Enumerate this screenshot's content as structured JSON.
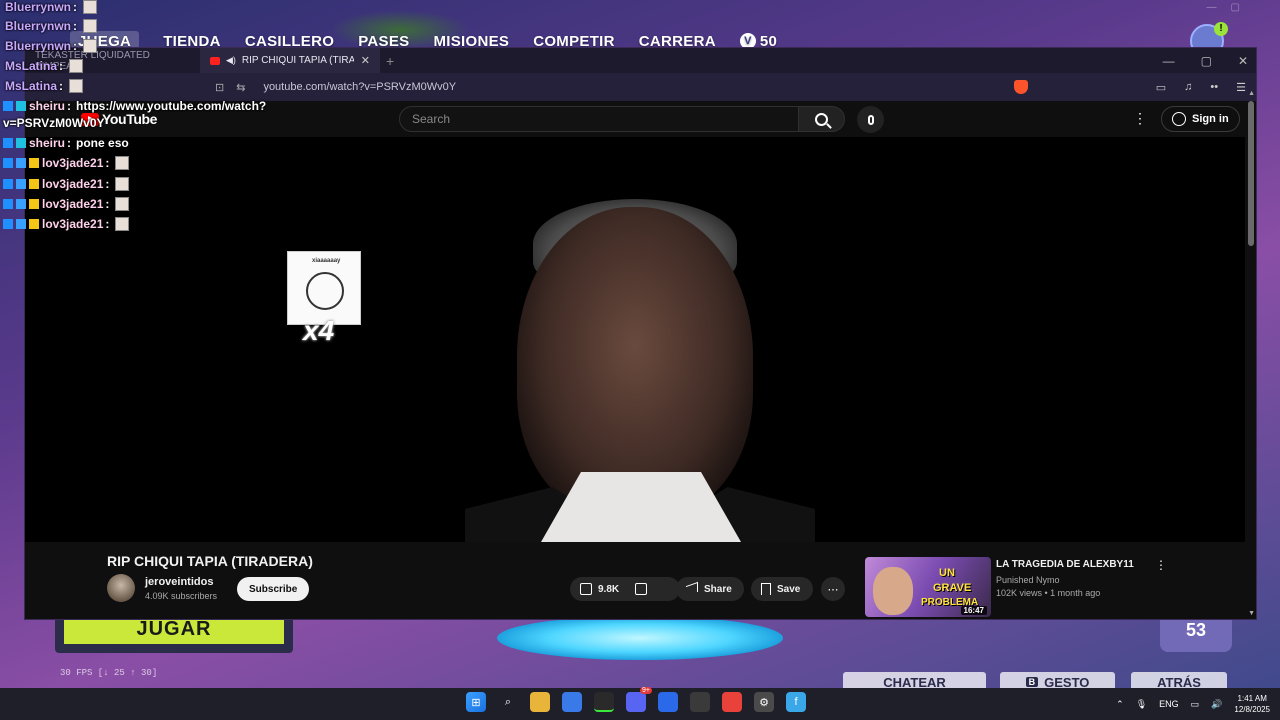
{
  "game": {
    "nav": [
      {
        "label": "JUEGA",
        "active": true
      },
      {
        "label": "TIENDA",
        "active": false
      },
      {
        "label": "CASILLERO",
        "active": false
      },
      {
        "label": "PASES",
        "active": false
      },
      {
        "label": "MISIONES",
        "active": false
      },
      {
        "label": "COMPETIR",
        "active": false
      },
      {
        "label": "CARRERA",
        "active": false
      }
    ],
    "vbucks_symbol": "V",
    "vbucks": "50",
    "avatar_badge": "!",
    "jugar_label": "JUGAR",
    "fps_text": "30 FPS [↓ 25 ↑ 30]",
    "level": "53",
    "footer_buttons": [
      {
        "key": "",
        "label": "CHATEAR"
      },
      {
        "key": "B",
        "label": "GESTO"
      },
      {
        "key": "",
        "label": "ATRÁS"
      }
    ]
  },
  "chat": [
    {
      "user": "Bluerrynwn",
      "message": "",
      "emote": true,
      "badges": [],
      "color": "purple"
    },
    {
      "user": "Bluerrynwn",
      "message": "",
      "emote": true,
      "badges": [],
      "color": "purple"
    },
    {
      "user": "Bluerrynwn",
      "message": "",
      "emote": true,
      "badges": [],
      "color": "purple"
    },
    {
      "user": "MsLatina",
      "message": "",
      "emote": true,
      "badges": [],
      "color": "purple"
    },
    {
      "user": "MsLatina",
      "message": "",
      "emote": true,
      "badges": [],
      "color": "purple"
    },
    {
      "user": "sheiru",
      "message": "https://www.youtube.com/watch?",
      "emote": false,
      "badges": [
        "b1",
        "b2"
      ],
      "color": "pink"
    },
    {
      "user": "",
      "message": "v=PSRVzM0Wv0Y",
      "emote": false,
      "badges": [],
      "color": "pink"
    },
    {
      "user": "sheiru",
      "message": "pone eso",
      "emote": false,
      "badges": [
        "b1",
        "b2"
      ],
      "color": "pink"
    },
    {
      "user": "lov3jade21",
      "message": "",
      "emote": true,
      "badges": [
        "b1",
        "b4",
        "b3"
      ],
      "color": "pink"
    },
    {
      "user": "lov3jade21",
      "message": "",
      "emote": true,
      "badges": [
        "b1",
        "b4",
        "b3"
      ],
      "color": "pink"
    },
    {
      "user": "lov3jade21",
      "message": "",
      "emote": true,
      "badges": [
        "b1",
        "b4",
        "b3"
      ],
      "color": "pink"
    },
    {
      "user": "lov3jade21",
      "message": "",
      "emote": true,
      "badges": [
        "b1",
        "b4",
        "b3"
      ],
      "color": "pink"
    }
  ],
  "browser": {
    "tabs": [
      {
        "title": "TEKASTER LIQUIDATED PIMPEA...",
        "active": false
      },
      {
        "title": "RIP CHIQUI TAPIA (TIRADERA)",
        "active": true
      }
    ],
    "url": "youtube.com/watch?v=PSRVzM0Wv0Y"
  },
  "youtube": {
    "logo": "YouTube",
    "search_placeholder": "Search",
    "signin": "Sign in",
    "sticker_label": "x4",
    "sticker_caption": "xiaaaaaay",
    "video_title": "RIP CHIQUI TAPIA (TIRADERA)",
    "channel_name": "jeroveintidos",
    "channel_subs": "4.09K subscribers",
    "subscribe": "Subscribe",
    "likes": "9.8K",
    "share": "Share",
    "save": "Save",
    "recommended": {
      "title": "LA TRAGEDIA DE ALEXBY11",
      "channel": "Punished Nymo",
      "meta": "102K views • 1 month ago",
      "duration": "16:47",
      "thumb_lines": [
        "UN",
        "GRAVE",
        "PROBLEMA"
      ]
    }
  },
  "taskbar": {
    "lang": "ENG",
    "time": "1:41 AM",
    "date": "12/8/2025",
    "discord_badge": "9+"
  }
}
